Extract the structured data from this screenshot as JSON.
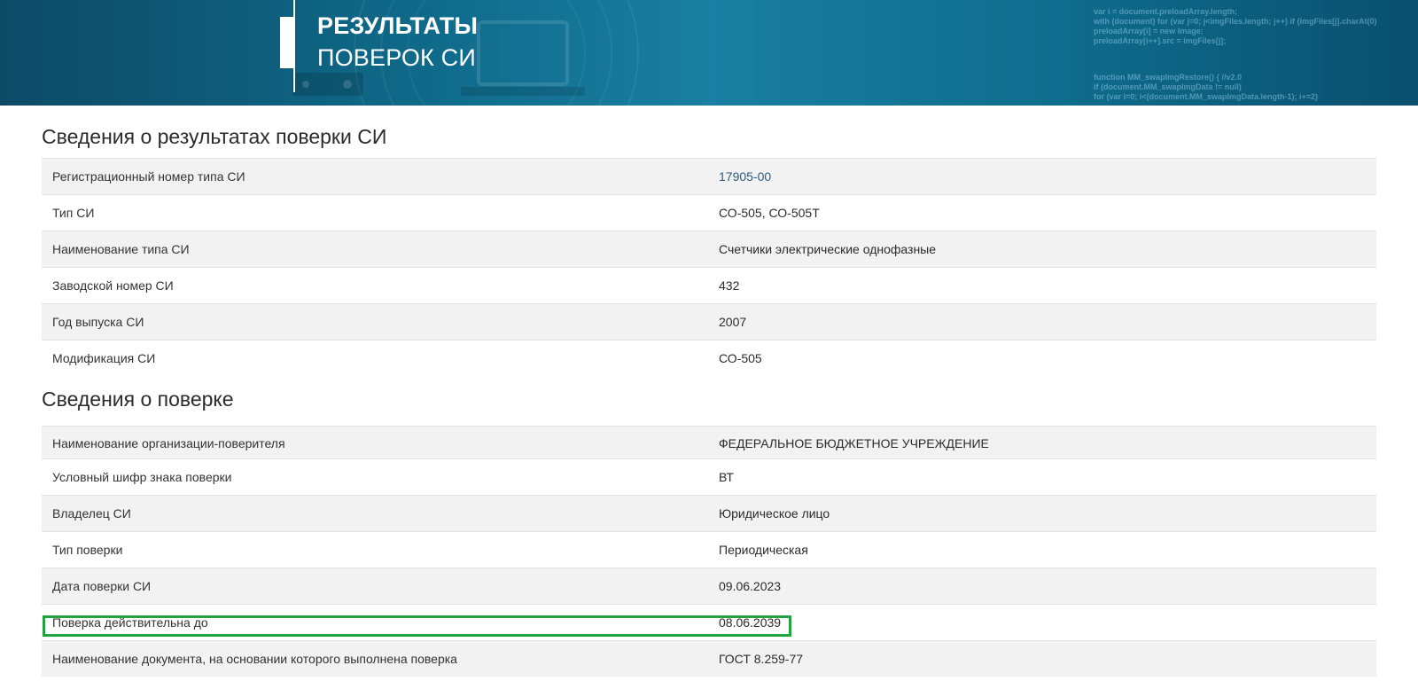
{
  "header": {
    "title_line1": "РЕЗУЛЬТАТЫ",
    "title_line2": "ПОВЕРОК СИ",
    "bg_code": [
      "var i = document.preloadArray.length;",
      "with (document) for (var j=0; j<imgFiles.length; j++) if (imgFiles[j].charAt(0)",
      "preloadArray[i] = new Image;",
      "preloadArray[i++].src = imgFiles[j];",
      "function MM_swapImgRestore() { //v2.0",
      "if (document.MM_swapImgData != null)",
      "for (var i=0; i<(document.MM_swapImgData.length-1); i+=2)"
    ]
  },
  "section_si": {
    "title": "Сведения о результатах поверки СИ",
    "rows": [
      {
        "label": "Регистрационный номер типа СИ",
        "value": "17905-00"
      },
      {
        "label": "Тип СИ",
        "value": "СО-505, СО-505Т"
      },
      {
        "label": "Наименование типа СИ",
        "value": "Счетчики электрические однофазные"
      },
      {
        "label": "Заводской номер СИ",
        "value": "432"
      },
      {
        "label": "Год выпуска СИ",
        "value": "2007"
      },
      {
        "label": "Модификация СИ",
        "value": "СО-505"
      }
    ]
  },
  "section_verification": {
    "title": "Сведения о поверке",
    "rows": [
      {
        "label": "Наименование организации-поверителя",
        "value": "ФЕДЕРАЛЬНОЕ БЮДЖЕТНОЕ УЧРЕЖДЕНИЕ"
      },
      {
        "label": "Условный шифр знака поверки",
        "value": "ВТ"
      },
      {
        "label": "Владелец СИ",
        "value": "Юридическое лицо"
      },
      {
        "label": "Тип поверки",
        "value": "Периодическая"
      },
      {
        "label": "Дата поверки СИ",
        "value": "09.06.2023"
      },
      {
        "label": "Поверка действительна до",
        "value": "08.06.2039"
      },
      {
        "label": "Наименование документа, на основании которого выполнена поверка",
        "value": "ГОСТ 8.259-77"
      }
    ]
  },
  "colors": {
    "banner": "#0f6a8a",
    "highlight": "#22a340",
    "link": "#2d5a78",
    "row_alt": "#f2f2f2"
  }
}
